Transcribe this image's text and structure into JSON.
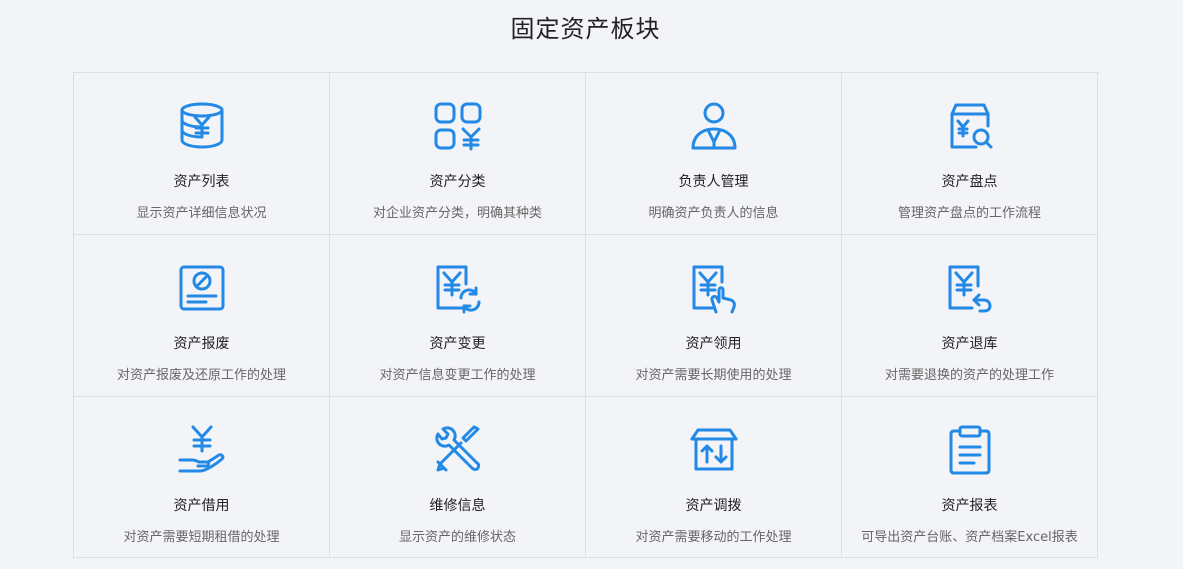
{
  "header": {
    "title": "固定资产板块"
  },
  "accent_color": "#2389e6",
  "modules": [
    {
      "icon": "coin-stack-yen-icon",
      "title": "资产列表",
      "desc": "显示资产详细信息状况"
    },
    {
      "icon": "category-grid-yen-icon",
      "title": "资产分类",
      "desc": "对企业资产分类，明确其种类"
    },
    {
      "icon": "person-manager-icon",
      "title": "负责人管理",
      "desc": "明确资产负责人的信息"
    },
    {
      "icon": "box-yen-search-icon",
      "title": "资产盘点",
      "desc": "管理资产盘点的工作流程"
    },
    {
      "icon": "card-scrap-icon",
      "title": "资产报废",
      "desc": "对资产报废及还原工作的处理"
    },
    {
      "icon": "doc-yen-refresh-icon",
      "title": "资产变更",
      "desc": "对资产信息变更工作的处理"
    },
    {
      "icon": "doc-yen-hand-icon",
      "title": "资产领用",
      "desc": "对资产需要长期使用的处理"
    },
    {
      "icon": "doc-yen-return-icon",
      "title": "资产退库",
      "desc": "对需要退换的资产的处理工作"
    },
    {
      "icon": "hand-yen-icon",
      "title": "资产借用",
      "desc": "对资产需要短期租借的处理"
    },
    {
      "icon": "wrench-screwdriver-icon",
      "title": "维修信息",
      "desc": "显示资产的维修状态"
    },
    {
      "icon": "box-transfer-icon",
      "title": "资产调拨",
      "desc": "对资产需要移动的工作处理"
    },
    {
      "icon": "clipboard-report-icon",
      "title": "资产报表",
      "desc": "可导出资产台账、资产档案Excel报表"
    }
  ]
}
